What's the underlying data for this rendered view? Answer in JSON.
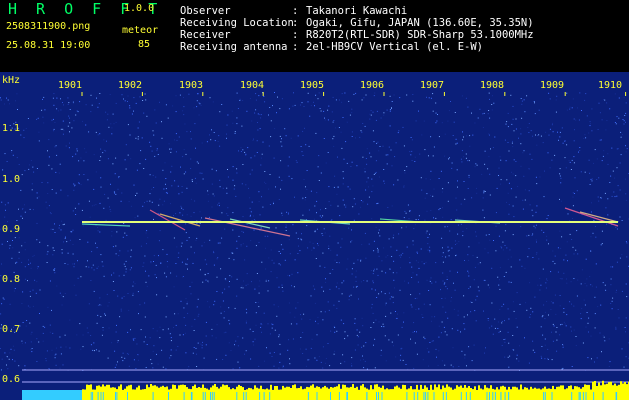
{
  "header": {
    "app_title": "H R O F F T",
    "version": "1.0.0",
    "filename": "2508311900.png",
    "datetime": "25.08.31 19:00",
    "meteor_label": "meteor",
    "meteor_count": "85",
    "info": [
      {
        "label": "Observer",
        "value": "Takanori Kawachi"
      },
      {
        "label": "Receiving Location",
        "value": "Ogaki, Gifu, JAPAN (136.60E, 35.35N)"
      },
      {
        "label": "Receiver",
        "value": "R820T2(RTL-SDR) SDR-Sharp 53.1000MHz"
      },
      {
        "label": "Receiving antenna",
        "value": "2el-HB9CV Vertical (el. E-W)"
      }
    ]
  },
  "axis": {
    "freq_unit": "kHz",
    "freq_labels": [
      "1.1",
      "1.0",
      "0.9",
      "0.8",
      "0.7",
      "0.6"
    ],
    "time_labels": [
      "1901",
      "1902",
      "1903",
      "1904",
      "1905",
      "1906",
      "1907",
      "1908",
      "1909",
      "1910"
    ]
  },
  "colors": {
    "background_noise": "#0b1f7a",
    "carrier_line": "#ffff66",
    "axis_text": "#ffff33",
    "activity_bar_yellow": "#ffff00",
    "activity_bar_cyan": "#33ccff"
  }
}
